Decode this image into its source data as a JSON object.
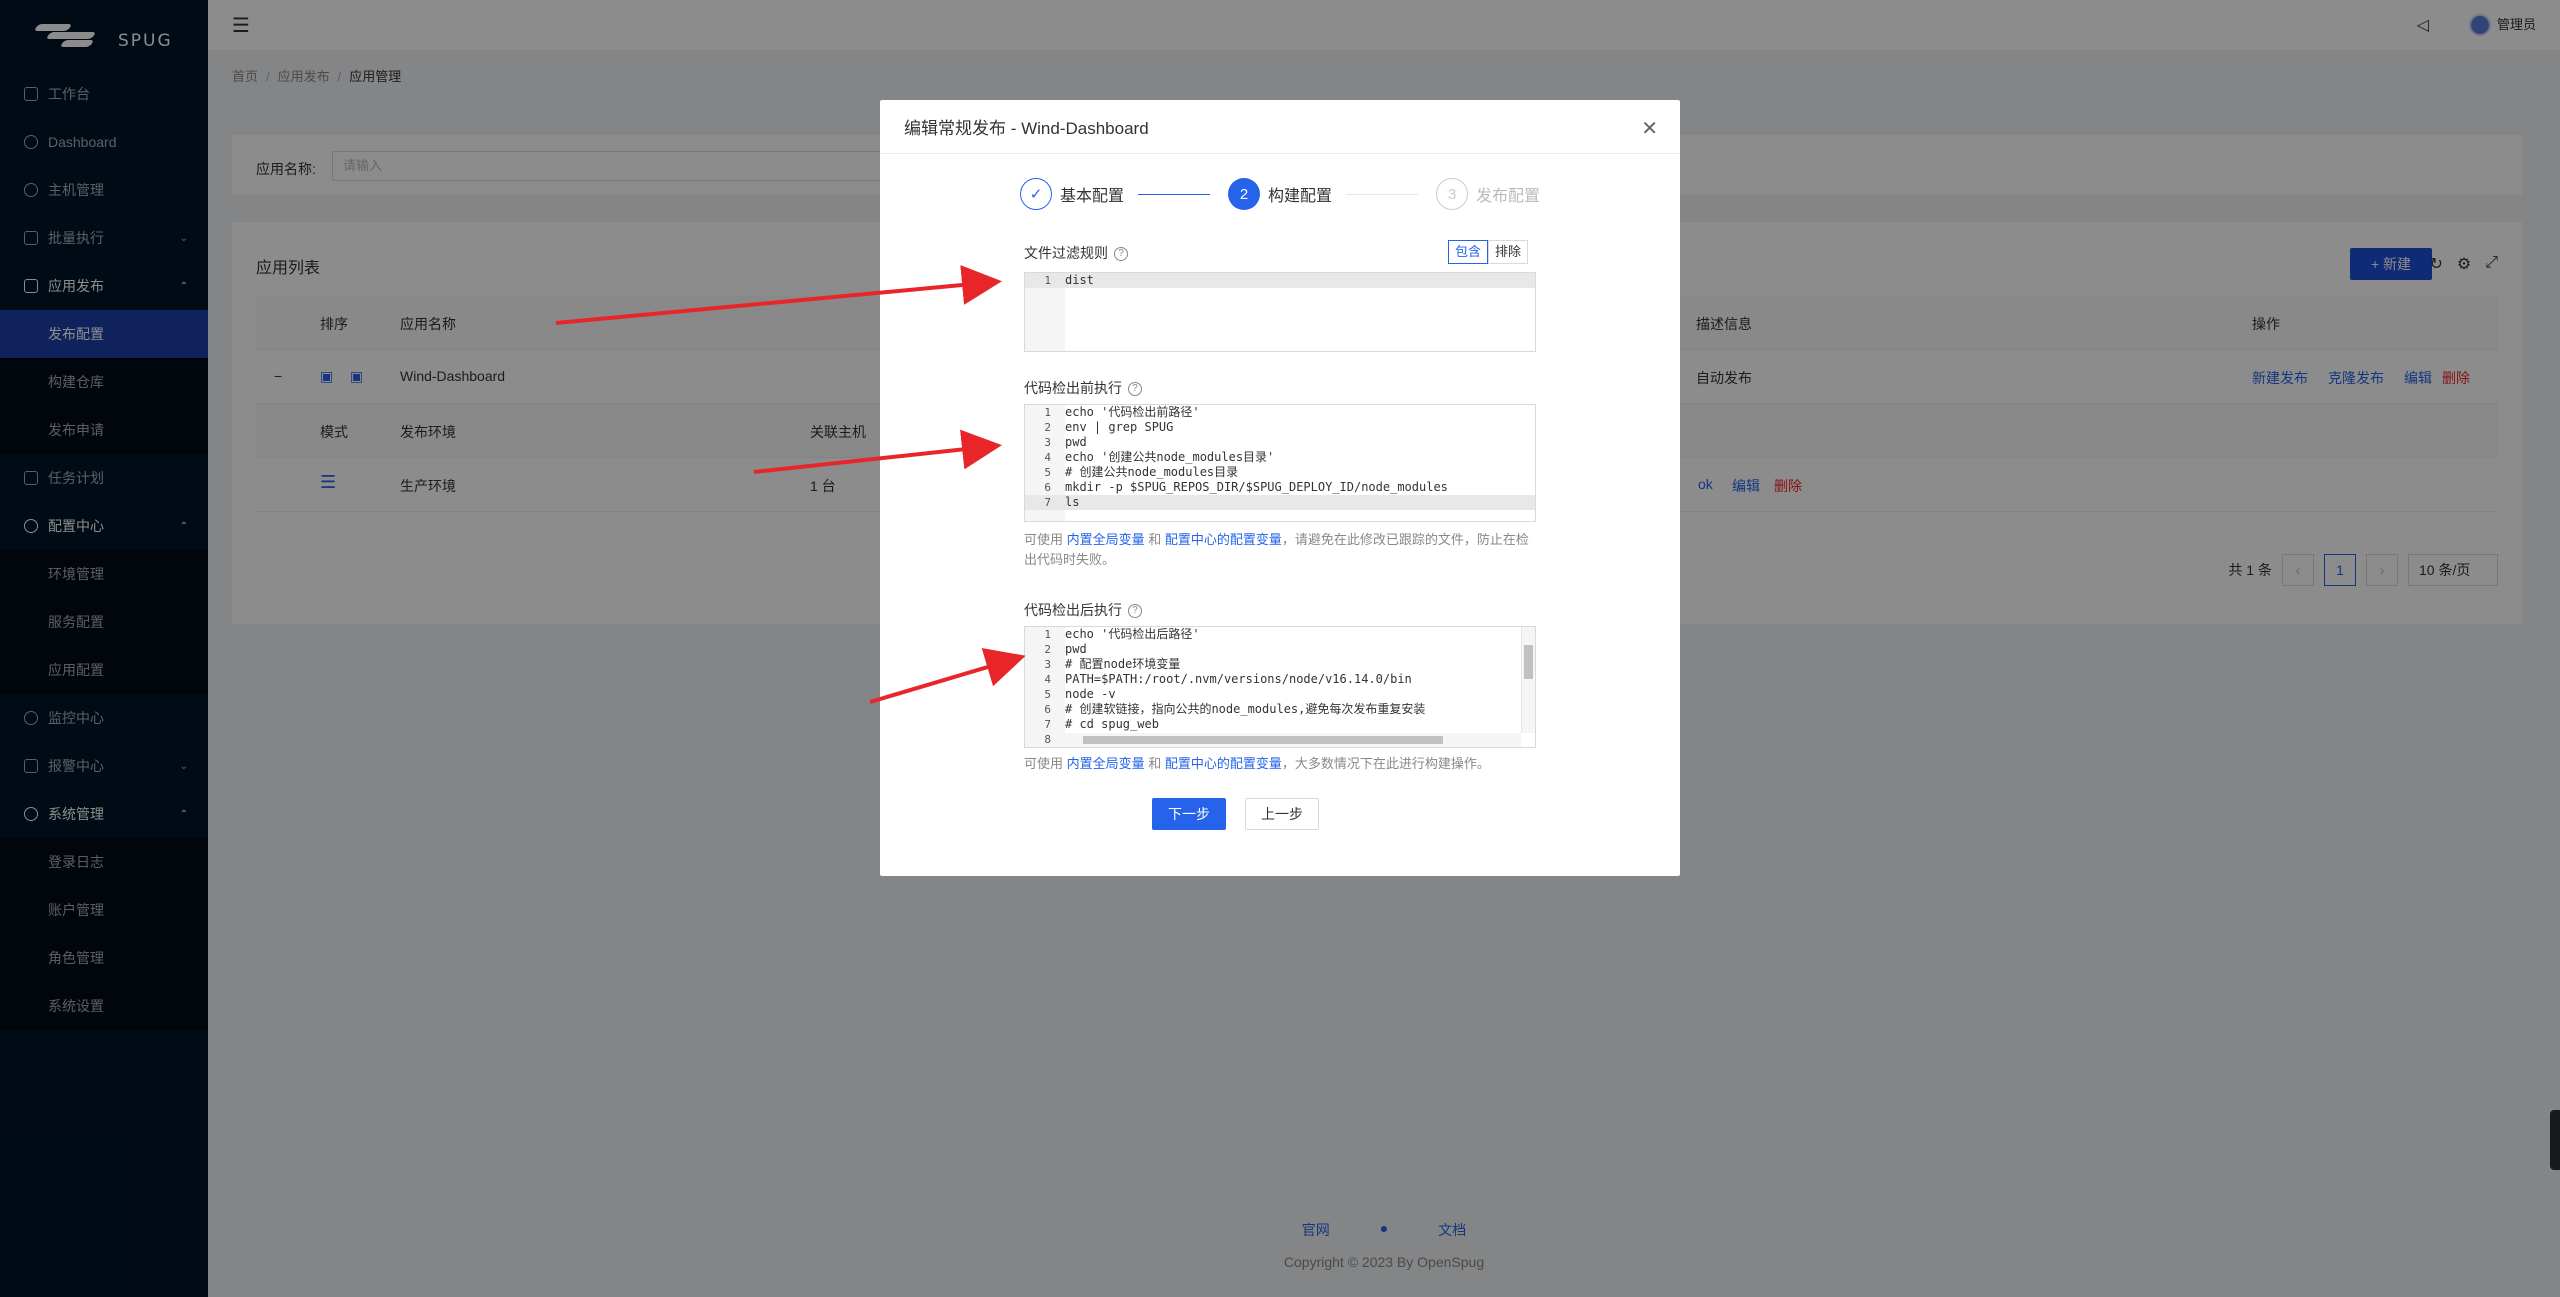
{
  "app": {
    "logo_text": "SPUG"
  },
  "sidebar": {
    "items": [
      {
        "label": "工作台"
      },
      {
        "label": "Dashboard"
      },
      {
        "label": "主机管理"
      },
      {
        "label": "批量执行",
        "arrow": "⌄"
      },
      {
        "label": "应用发布",
        "arrow": "⌃"
      },
      {
        "label": "发布配置"
      },
      {
        "label": "构建仓库"
      },
      {
        "label": "发布申请"
      },
      {
        "label": "任务计划"
      },
      {
        "label": "配置中心",
        "arrow": "⌃"
      },
      {
        "label": "环境管理"
      },
      {
        "label": "服务配置"
      },
      {
        "label": "应用配置"
      },
      {
        "label": "监控中心"
      },
      {
        "label": "报警中心",
        "arrow": "⌄"
      },
      {
        "label": "系统管理",
        "arrow": "⌃"
      },
      {
        "label": "登录日志"
      },
      {
        "label": "账户管理"
      },
      {
        "label": "角色管理"
      },
      {
        "label": "系统设置"
      }
    ]
  },
  "header": {
    "user": "管理员"
  },
  "breadcrumb": [
    "首页",
    "应用发布",
    "应用管理"
  ],
  "search": {
    "label": "应用名称:",
    "placeholder": "请输入"
  },
  "list": {
    "title": "应用列表",
    "new_label": "+ 新建",
    "columns": [
      "排序",
      "应用名称",
      "描述信息",
      "操作"
    ],
    "app_row": {
      "name": "Wind-Dashboard",
      "desc": "自动发布",
      "actions": [
        "新建发布",
        "克隆发布",
        "编辑",
        "删除"
      ]
    },
    "sub_columns": [
      "模式",
      "发布环境",
      "关联主机"
    ],
    "sub_row": {
      "env": "生产环境",
      "hosts": "1 台",
      "actions": [
        "ok",
        "编辑",
        "删除"
      ]
    },
    "pager": {
      "total": "共 1 条",
      "page": "1",
      "size": "10 条/页"
    }
  },
  "footer": {
    "links": [
      "官网",
      "文档"
    ],
    "copyright": "Copyright © 2023 By OpenSpug"
  },
  "modal": {
    "title": "编辑常规发布 - Wind-Dashboard",
    "steps": [
      {
        "label": "基本配置",
        "mark": "✓"
      },
      {
        "label": "构建配置",
        "mark": "2"
      },
      {
        "label": "发布配置",
        "mark": "3"
      }
    ],
    "filter": {
      "label": "文件过滤规则",
      "include": "包含",
      "exclude": "排除",
      "code": [
        "dist"
      ]
    },
    "pre": {
      "label": "代码检出前执行",
      "code": [
        "echo '代码检出前路径'",
        "env | grep SPUG",
        "pwd",
        "echo '创建公共node_modules目录'",
        "# 创建公共node_modules目录",
        "mkdir -p $SPUG_REPOS_DIR/$SPUG_DEPLOY_ID/node_modules",
        "ls"
      ],
      "hint_a": "可使用 ",
      "hint_link1": "内置全局变量",
      "hint_b": " 和 ",
      "hint_link2": "配置中心的配置变量",
      "hint_c": "，请避免在此修改已跟踪的文件，防止在检出代码时失败。"
    },
    "post": {
      "label": "代码检出后执行",
      "code": [
        "echo '代码检出后路径'",
        "pwd",
        "# 配置node环境变量",
        "PATH=$PATH:/root/.nvm/versions/node/v16.14.0/bin",
        "node -v",
        "# 创建软链接，指向公共的node_modules,避免每次发布重复安装",
        "# cd spug_web",
        ""
      ],
      "hint_a": "可使用 ",
      "hint_link1": "内置全局变量",
      "hint_b": " 和 ",
      "hint_link2": "配置中心的配置变量",
      "hint_c": "，大多数情况下在此进行构建操作。"
    },
    "next": "下一步",
    "prev": "上一步"
  },
  "colors": {
    "primary": "#2563eb",
    "sidebar": "#001529",
    "danger": "#f5222d",
    "arrow": "#e8262a"
  }
}
